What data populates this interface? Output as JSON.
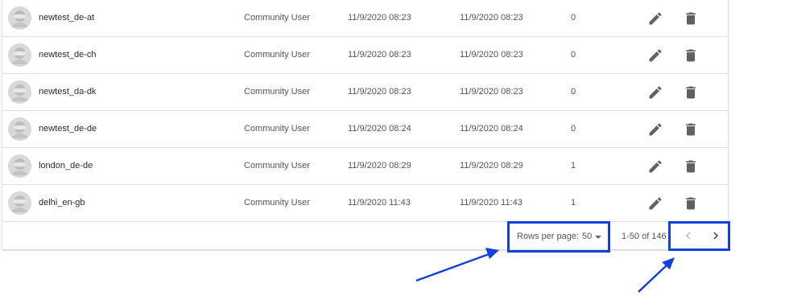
{
  "rows": [
    {
      "name": "newtest_de-at",
      "type": "Community User",
      "created": "11/9/2020 08:23",
      "modified": "11/9/2020 08:23",
      "count": "0"
    },
    {
      "name": "newtest_de-ch",
      "type": "Community User",
      "created": "11/9/2020 08:23",
      "modified": "11/9/2020 08:23",
      "count": "0"
    },
    {
      "name": "newtest_da-dk",
      "type": "Community User",
      "created": "11/9/2020 08:23",
      "modified": "11/9/2020 08:23",
      "count": "0"
    },
    {
      "name": "newtest_de-de",
      "type": "Community User",
      "created": "11/9/2020 08:24",
      "modified": "11/9/2020 08:24",
      "count": "0"
    },
    {
      "name": "london_de-de",
      "type": "Community User",
      "created": "11/9/2020 08:29",
      "modified": "11/9/2020 08:29",
      "count": "1"
    },
    {
      "name": "delhi_en-gb",
      "type": "Community User",
      "created": "11/9/2020 11:43",
      "modified": "11/9/2020 11:43",
      "count": "1"
    }
  ],
  "pagination": {
    "rows_per_page_label": "Rows per page:",
    "rows_per_page_value": "50",
    "range_text": "1-50 of 146"
  },
  "icons": {
    "avatar": "user-avatar-icon",
    "edit": "pencil-icon",
    "delete": "trash-icon",
    "dropdown": "caret-down-icon",
    "prev": "chevron-left-icon",
    "next": "chevron-right-icon"
  },
  "colors": {
    "highlight": "#1240d8",
    "icon": "#616161",
    "disabled": "#bdbdbd",
    "divider": "#e0e0e0"
  }
}
